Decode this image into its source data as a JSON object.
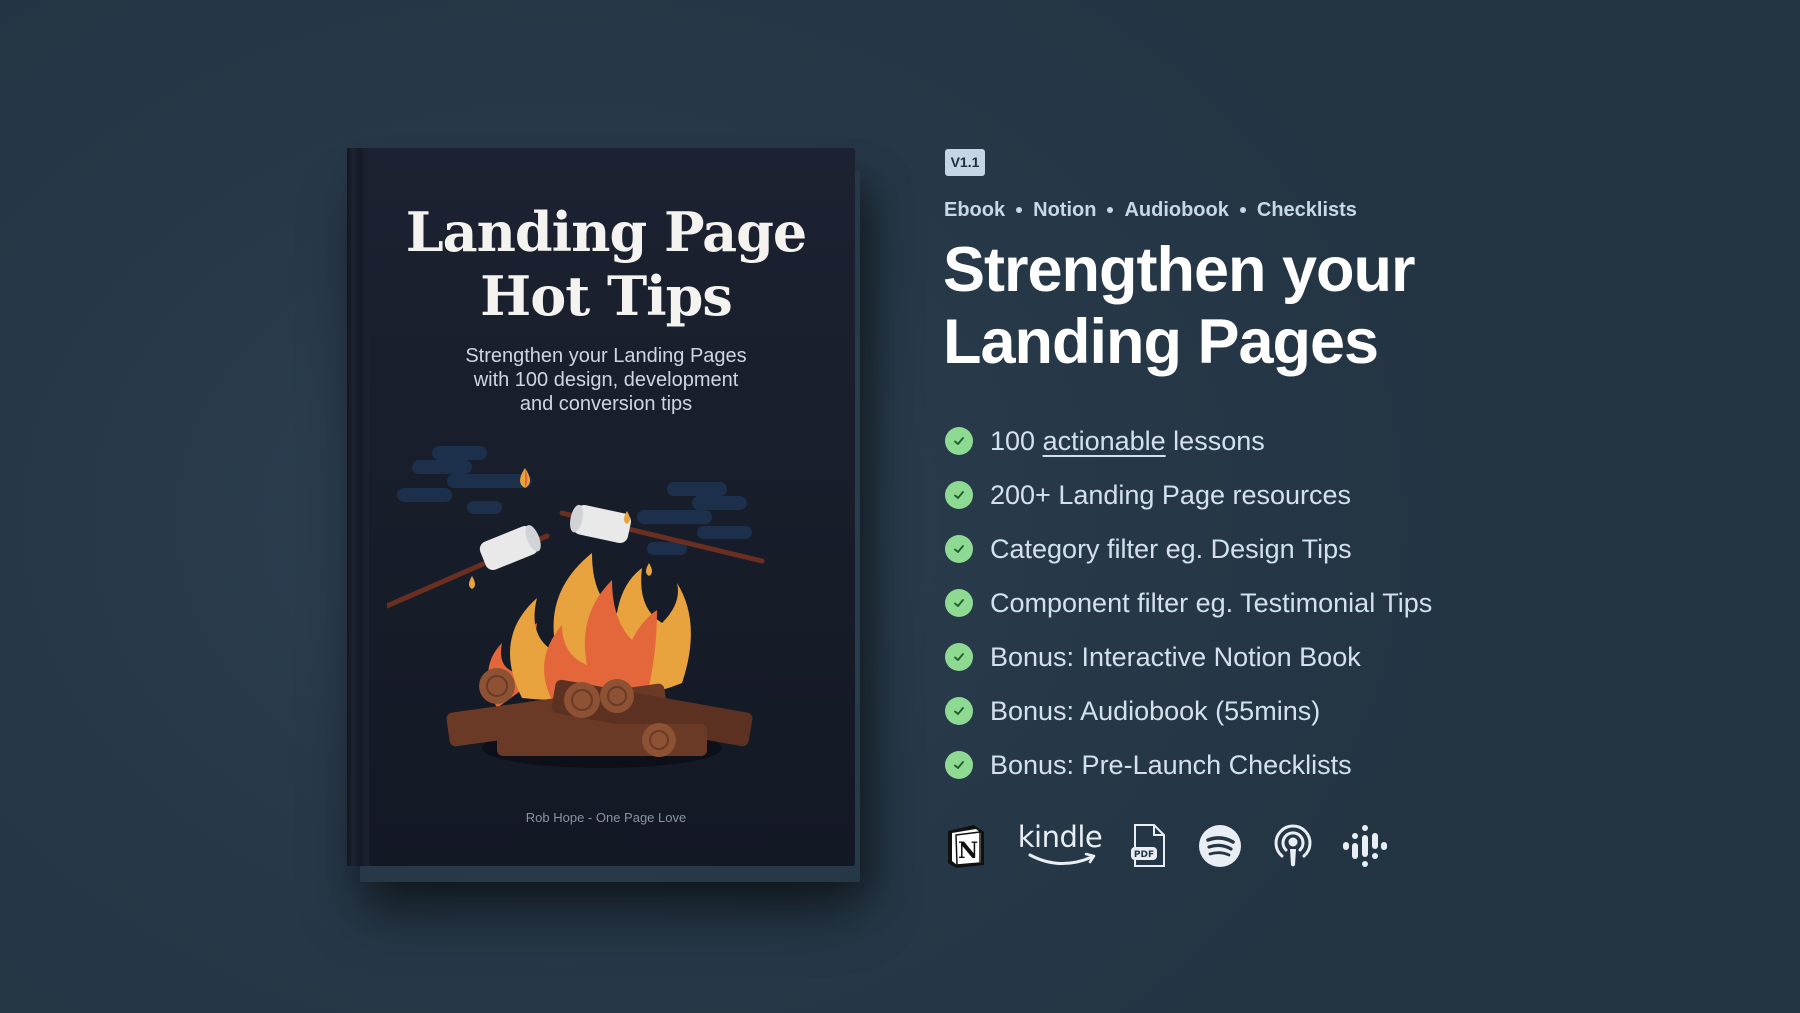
{
  "book": {
    "title_lines": [
      "Landing Page",
      "Hot Tips"
    ],
    "subtitle_lines": [
      "Strengthen your Landing Pages",
      "with 100 design, development",
      "and conversion tips"
    ],
    "author": "Rob Hope - One Page Love",
    "illustration": "campfire-with-roasting-marshmallows"
  },
  "version_badge": "V1.1",
  "formats": [
    "Ebook",
    "Notion",
    "Audiobook",
    "Checklists"
  ],
  "headline_lines": [
    "Strengthen your",
    "Landing Pages"
  ],
  "features": [
    {
      "pre": "100 ",
      "link": "actionable",
      "post": " lessons"
    },
    {
      "pre": "200+ Landing Page resources",
      "link": "",
      "post": ""
    },
    {
      "pre": "Category filter eg. Design Tips",
      "link": "",
      "post": ""
    },
    {
      "pre": "Component filter eg. Testimonial Tips",
      "link": "",
      "post": ""
    },
    {
      "pre": "Bonus: Interactive Notion Book",
      "link": "",
      "post": ""
    },
    {
      "pre": "Bonus: Audiobook (55mins)",
      "link": "",
      "post": ""
    },
    {
      "pre": "Bonus: Pre-Launch Checklists",
      "link": "",
      "post": ""
    }
  ],
  "platform_icons": [
    {
      "name": "notion-icon",
      "label": "N"
    },
    {
      "name": "kindle-icon",
      "label": "kindle"
    },
    {
      "name": "pdf-icon",
      "label": "PDF"
    },
    {
      "name": "spotify-icon",
      "label": ""
    },
    {
      "name": "apple-podcasts-icon",
      "label": ""
    },
    {
      "name": "google-podcasts-icon",
      "label": ""
    }
  ],
  "colors": {
    "background": "#263848",
    "book_cover": "#181d2a",
    "check": "#8fda93",
    "badge": "#c3d5e6",
    "headline": "#ffffff",
    "feature_text": "#d5e0ec"
  }
}
